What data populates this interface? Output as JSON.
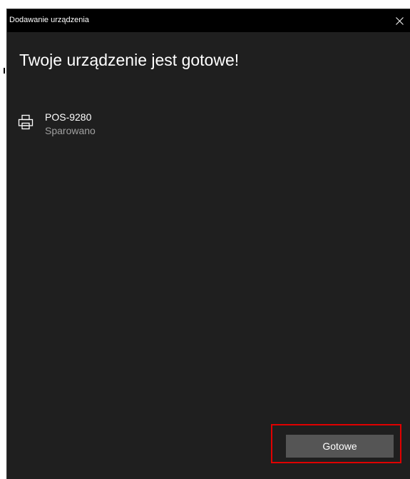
{
  "window": {
    "title": "Dodawanie urządzenia",
    "close_icon": "close-icon"
  },
  "main": {
    "heading": "Twoje urządzenie jest gotowe!"
  },
  "device": {
    "icon": "printer-icon",
    "name": "POS-9280",
    "status": "Sparowano"
  },
  "footer": {
    "done_label": "Gotowe"
  },
  "colors": {
    "background": "#1f1f1f",
    "titlebar": "#000000",
    "button": "#555555",
    "highlight": "#e00000",
    "secondary_text": "#a0a0a0"
  }
}
